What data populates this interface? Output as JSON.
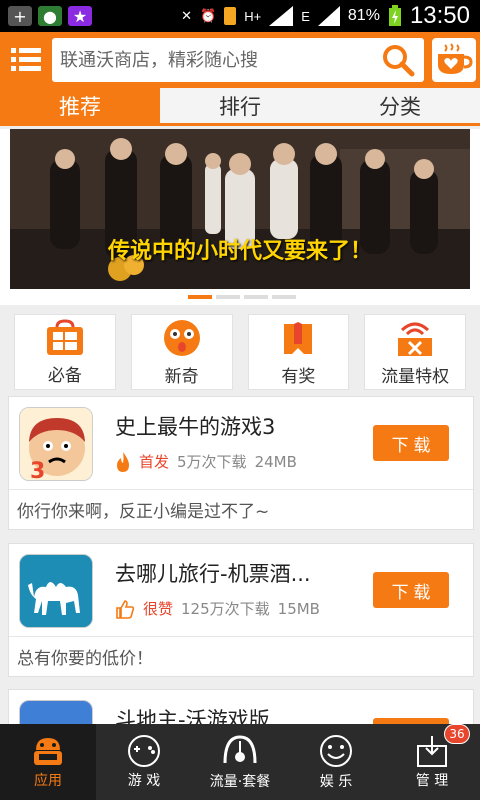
{
  "status_bar": {
    "time": "13:50",
    "battery": "81%",
    "network_type": "E",
    "network_type2": "H+"
  },
  "header": {
    "search_placeholder": "联通沃商店，精彩随心搜",
    "accent": "#f57a13"
  },
  "tabs": [
    {
      "label": "推荐",
      "active": true
    },
    {
      "label": "排行",
      "active": false
    },
    {
      "label": "分类",
      "active": false
    }
  ],
  "banner": {
    "caption": "传说中的小时代又要来了！"
  },
  "categories": [
    {
      "label": "必备",
      "icon": "windows-bag-icon"
    },
    {
      "label": "新奇",
      "icon": "surprised-face-icon"
    },
    {
      "label": "有奖",
      "icon": "prize-ribbon-icon"
    },
    {
      "label": "流量特权",
      "icon": "wifi-ticket-icon"
    }
  ],
  "apps": [
    {
      "name": "史上最牛的游戏3",
      "tag": "首发",
      "downloads": "5万次下载",
      "size": "24MB",
      "button": "下 载",
      "desc": "你行你来啊，反正小编是过不了~"
    },
    {
      "name": "去哪儿旅行-机票酒...",
      "tag": "很赞",
      "downloads": "125万次下载",
      "size": "15MB",
      "button": "下 载",
      "desc": "总有你要的低价！"
    },
    {
      "name": "斗地主-沃游戏版"
    }
  ],
  "bottom_nav": [
    {
      "label": "应用",
      "active": true
    },
    {
      "label": "游 戏",
      "active": false
    },
    {
      "label": "流量·套餐",
      "active": false
    },
    {
      "label": "娱 乐",
      "active": false
    },
    {
      "label": "管 理",
      "active": false,
      "badge": "36"
    }
  ]
}
